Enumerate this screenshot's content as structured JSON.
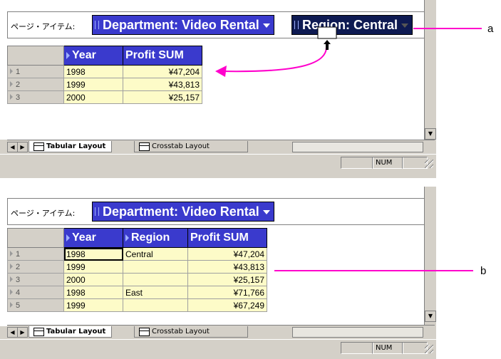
{
  "colors": {
    "accent_blue": "#3a3acd",
    "dark_navy": "#0e1a52",
    "cell_yellow": "#fdfbc8",
    "annotation_magenta": "#ff00cc",
    "chrome_gray": "#d4d0c8"
  },
  "top_panel": {
    "page_items_label": "ページ・アイテム:",
    "chips": {
      "department": "Department: Video Rental",
      "region": "Region: Central"
    },
    "columns": {
      "year": "Year",
      "profit": "Profit SUM"
    },
    "rows": [
      {
        "num": "1",
        "year": "1998",
        "profit": "¥47,204"
      },
      {
        "num": "2",
        "year": "1999",
        "profit": "¥43,813"
      },
      {
        "num": "3",
        "year": "2000",
        "profit": "¥25,157"
      }
    ],
    "tabs": {
      "tabular": "Tabular Layout",
      "crosstab": "Crosstab Layout"
    },
    "status": "NUM"
  },
  "bottom_panel": {
    "page_items_label": "ページ・アイテム:",
    "chips": {
      "department": "Department: Video Rental"
    },
    "columns": {
      "year": "Year",
      "region": "Region",
      "profit": "Profit SUM"
    },
    "rows": [
      {
        "num": "1",
        "year": "1998",
        "region": "Central",
        "profit": "¥47,204"
      },
      {
        "num": "2",
        "year": "1999",
        "region": "",
        "profit": "¥43,813"
      },
      {
        "num": "3",
        "year": "2000",
        "region": "",
        "profit": "¥25,157"
      },
      {
        "num": "4",
        "year": "1998",
        "region": "East",
        "profit": "¥71,766"
      },
      {
        "num": "5",
        "year": "1999",
        "region": "",
        "profit": "¥67,249"
      }
    ],
    "tabs": {
      "tabular": "Tabular Layout",
      "crosstab": "Crosstab Layout"
    },
    "status": "NUM"
  },
  "annotations": {
    "a": "a",
    "b": "b"
  }
}
